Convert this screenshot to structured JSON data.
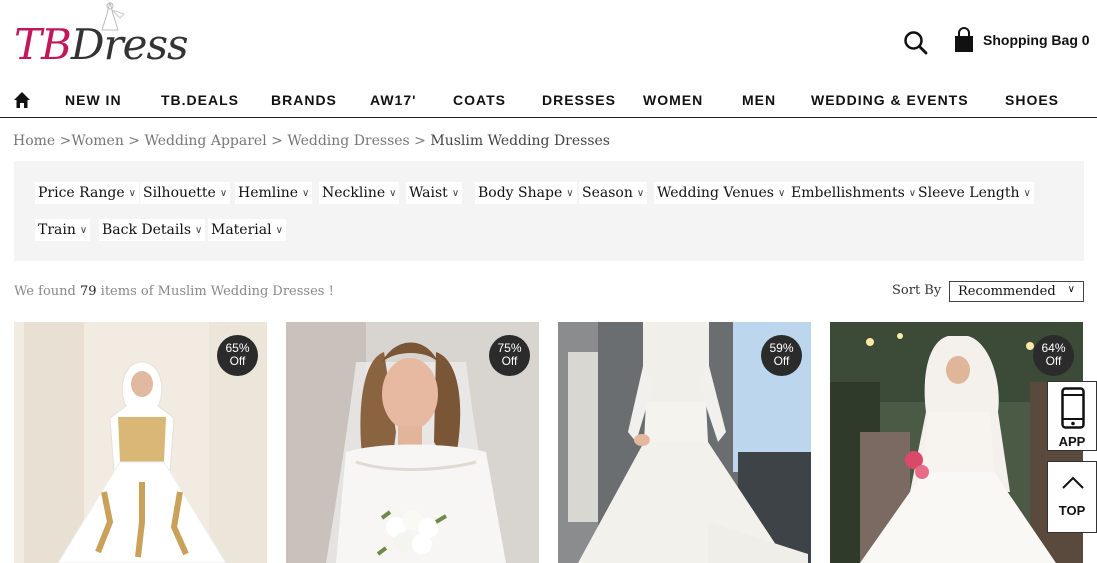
{
  "header": {
    "logo_tb": "TB",
    "logo_dress": "Dress",
    "bag_label": "Shopping Bag 0"
  },
  "nav": {
    "items": [
      "NEW IN",
      "TB.DEALS",
      "BRANDS",
      "AW17'",
      "COATS",
      "DRESSES",
      "WOMEN",
      "MEN",
      "WEDDING & EVENTS",
      "SHOES"
    ]
  },
  "breadcrumb": {
    "items": [
      "Home",
      "Women",
      "Wedding Apparel",
      "Wedding Dresses",
      "Muslim Wedding Dresses"
    ]
  },
  "filters": {
    "row1": [
      "Price Range",
      "Silhouette",
      "Hemline",
      "Neckline",
      "Waist",
      "Body Shape",
      "Season",
      "Wedding Venues",
      "Embellishments",
      "Sleeve Length"
    ],
    "row2": [
      "Train",
      "Back Details",
      "Material"
    ]
  },
  "results": {
    "prefix": "We found",
    "count": "79",
    "middle": "items of",
    "category": "Muslim Wedding Dresses !"
  },
  "sort": {
    "label": "Sort By",
    "value": "Recommended"
  },
  "products": [
    {
      "discount_pct": "65%",
      "discount_word": "Off"
    },
    {
      "discount_pct": "75%",
      "discount_word": "Off"
    },
    {
      "discount_pct": "59%",
      "discount_word": "Off"
    },
    {
      "discount_pct": "64%",
      "discount_word": "Off"
    }
  ],
  "floating": {
    "app_label": "APP",
    "top_label": "TOP"
  },
  "colors": {
    "logo_accent": "#c2185b",
    "badge_bg": "#2b2b2b",
    "filter_panel_bg": "#f4f4f4"
  }
}
